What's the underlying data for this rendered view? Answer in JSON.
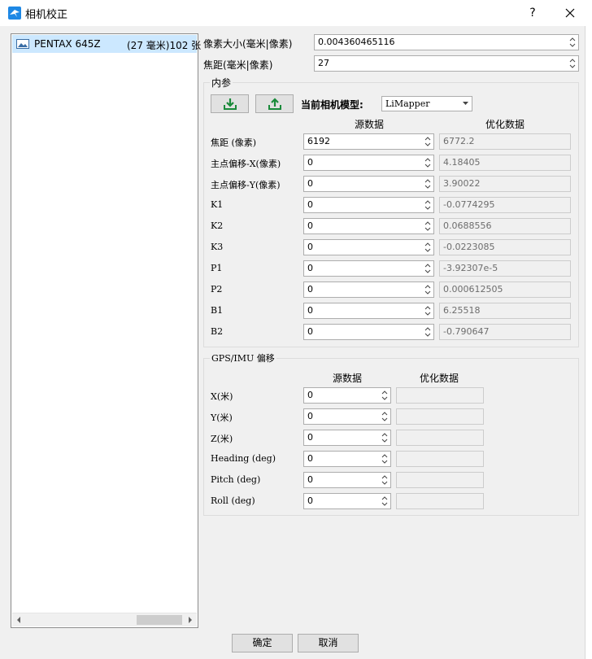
{
  "window": {
    "title": "相机校正",
    "help": "?"
  },
  "camera_list": {
    "items": [
      {
        "name": "PENTAX 645Z",
        "detail": "(27 毫米)102 张"
      }
    ]
  },
  "pixel_size": {
    "label": "像素大小(毫米|像素)",
    "value": "0.004360465116"
  },
  "focal_mm": {
    "label": "焦距(毫米|像素)",
    "value": "27"
  },
  "intrinsics": {
    "title": "内参",
    "model_label": "当前相机模型:",
    "model_value": "LiMapper",
    "col_source": "源数据",
    "col_optimized": "优化数据",
    "rows": [
      {
        "label": "焦距 (像素)",
        "source": "6192",
        "optimized": "6772.2"
      },
      {
        "label": "主点偏移-X(像素)",
        "source": "0",
        "optimized": "4.18405"
      },
      {
        "label": "主点偏移-Y(像素)",
        "source": "0",
        "optimized": "3.90022"
      },
      {
        "label": "K1",
        "source": "0",
        "optimized": "-0.0774295"
      },
      {
        "label": "K2",
        "source": "0",
        "optimized": "0.0688556"
      },
      {
        "label": "K3",
        "source": "0",
        "optimized": "-0.0223085"
      },
      {
        "label": "P1",
        "source": "0",
        "optimized": "-3.92307e-5"
      },
      {
        "label": "P2",
        "source": "0",
        "optimized": "0.000612505"
      },
      {
        "label": "B1",
        "source": "0",
        "optimized": "6.25518"
      },
      {
        "label": "B2",
        "source": "0",
        "optimized": "-0.790647"
      }
    ]
  },
  "gps": {
    "title": "GPS/IMU 偏移",
    "col_source": "源数据",
    "col_optimized": "优化数据",
    "rows": [
      {
        "label": "X(米)",
        "source": "0",
        "optimized": ""
      },
      {
        "label": "Y(米)",
        "source": "0",
        "optimized": ""
      },
      {
        "label": "Z(米)",
        "source": "0",
        "optimized": ""
      },
      {
        "label": "Heading (deg)",
        "source": "0",
        "optimized": ""
      },
      {
        "label": "Pitch (deg)",
        "source": "0",
        "optimized": ""
      },
      {
        "label": "Roll (deg)",
        "source": "0",
        "optimized": ""
      }
    ]
  },
  "buttons": {
    "ok": "确定",
    "cancel": "取消"
  }
}
